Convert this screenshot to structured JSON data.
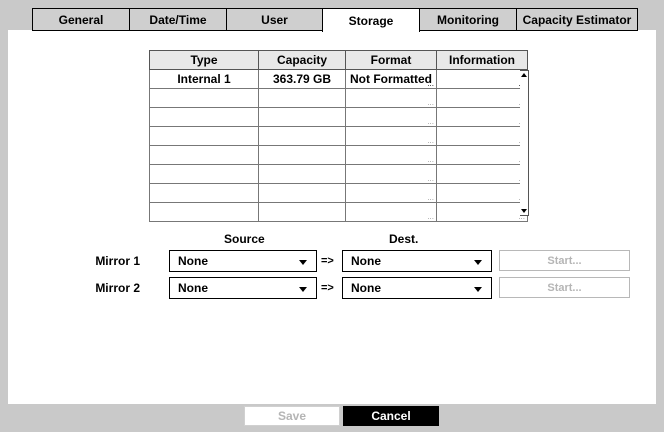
{
  "tabs": [
    {
      "label": "General"
    },
    {
      "label": "Date/Time"
    },
    {
      "label": "User"
    },
    {
      "label": "Storage",
      "active": true
    },
    {
      "label": "Monitoring"
    },
    {
      "label": "Capacity Estimator"
    }
  ],
  "table": {
    "headers": [
      "Type",
      "Capacity",
      "Format",
      "Information"
    ],
    "rows": [
      [
        "Internal 1",
        "363.79 GB",
        "Not Formatted",
        ""
      ],
      [
        "",
        "",
        "",
        ""
      ],
      [
        "",
        "",
        "",
        ""
      ],
      [
        "",
        "",
        "",
        ""
      ],
      [
        "",
        "",
        "",
        ""
      ],
      [
        "",
        "",
        "",
        ""
      ],
      [
        "",
        "",
        "",
        ""
      ],
      [
        "",
        "",
        "",
        ""
      ]
    ],
    "ellipsis": "..."
  },
  "mirror": {
    "source_label": "Source",
    "dest_label": "Dest.",
    "arrow": "=>",
    "rows": [
      {
        "label": "Mirror 1",
        "source": "None",
        "dest": "None",
        "start": "Start..."
      },
      {
        "label": "Mirror 2",
        "source": "None",
        "dest": "None",
        "start": "Start..."
      }
    ]
  },
  "footer": {
    "save": "Save",
    "cancel": "Cancel"
  },
  "colors": {
    "chrome": "#c9c9c9",
    "disabled_text": "#b5b5b5",
    "cancel_bg": "#000000"
  }
}
